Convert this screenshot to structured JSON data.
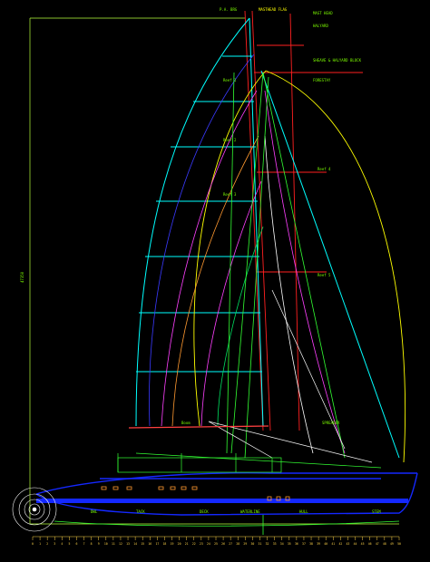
{
  "colors": {
    "background": "#000000",
    "hull": "#1428FF",
    "mast": "#FF2020",
    "sail_grid": "#00FFFF",
    "spinnaker": "#FFFF00",
    "label": "#7CFC00",
    "scale": "#FFD54A"
  },
  "labels": {
    "top_left": "P.A. BRG",
    "top_mid": "MASTHEAD FLAG",
    "top_right": "MAST HEAD",
    "halyard": "HALYARD",
    "block_a": "SHEAVE & HALYARD BLOCK",
    "forestay": "FORESTAY",
    "reef1": "Reef 1",
    "reef2": "Reef 2",
    "reef3": "Reef 3",
    "reef4": "Reef 4",
    "reef5": "Reef 5",
    "spreader": "SPREADER",
    "side_dim": "47350",
    "boom": "Boom",
    "deck": "DECK",
    "wl": "DWL",
    "waterline": "WATERLINE",
    "stem": "STEM",
    "hull_note": "HULL",
    "lower_label": "TACK"
  },
  "scale_ticks": [
    "0",
    "1",
    "2",
    "3",
    "4",
    "5",
    "6",
    "7",
    "8",
    "9",
    "10",
    "11",
    "12",
    "13",
    "14",
    "15",
    "16",
    "17",
    "18",
    "19",
    "20",
    "21",
    "22",
    "23",
    "24",
    "25",
    "26",
    "27",
    "28",
    "29",
    "30",
    "31",
    "32",
    "33",
    "34",
    "35",
    "36",
    "37",
    "38",
    "39",
    "40",
    "41",
    "42",
    "43",
    "44",
    "45",
    "46",
    "47",
    "48",
    "49",
    "50"
  ]
}
